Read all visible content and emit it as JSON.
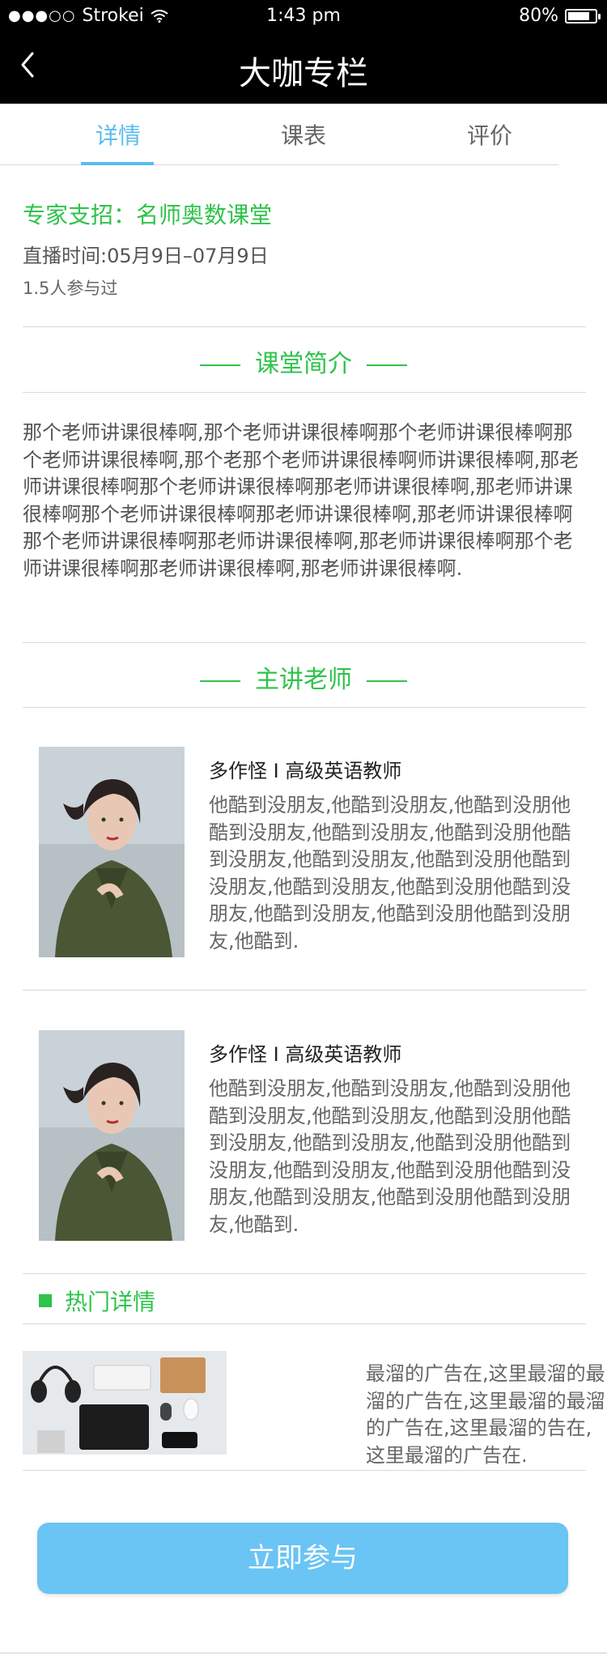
{
  "status_bar": {
    "carrier": "Strokei",
    "signal_dots": "●●●○○",
    "time": "1:43 pm",
    "battery_pct": "80%",
    "battery_level": 0.8
  },
  "nav": {
    "title": "大咖专栏"
  },
  "tabs": [
    {
      "label": "详情",
      "active": true
    },
    {
      "label": "课表",
      "active": false
    },
    {
      "label": "评价",
      "active": false
    }
  ],
  "course": {
    "expert": "专家支招：名师奥数课堂",
    "broadcast_time": "直播时间:05月9日–07月9日",
    "participants": "1.5人参与过"
  },
  "sections": {
    "intro_title": "课堂简介",
    "teacher_title": "主讲老师",
    "hot_title": "热门详情"
  },
  "intro_text": "那个老师讲课很棒啊,那个老师讲课很棒啊那个老师讲课很棒啊那个老师讲课很棒啊,那个老那个老师讲课很棒啊师讲课很棒啊,那老师讲课很棒啊那个老师讲课很棒啊那老师讲课很棒啊,那老师讲课很棒啊那个老师讲课很棒啊那老师讲课很棒啊,那老师讲课很棒啊那个老师讲课很棒啊那老师讲课很棒啊,那老师讲课很棒啊那个老师讲课很棒啊那老师讲课很棒啊,那老师讲课很棒啊.",
  "teachers": [
    {
      "name": "多作怪 I 高级英语教师",
      "desc": "他酷到没朋友,他酷到没朋友,他酷到没朋他酷到没朋友,他酷到没朋友,他酷到没朋他酷到没朋友,他酷到没朋友,他酷到没朋他酷到没朋友,他酷到没朋友,他酷到没朋他酷到没朋友,他酷到没朋友,他酷到没朋他酷到没朋友,他酷到."
    },
    {
      "name": "多作怪 I 高级英语教师",
      "desc": "他酷到没朋友,他酷到没朋友,他酷到没朋他酷到没朋友,他酷到没朋友,他酷到没朋他酷到没朋友,他酷到没朋友,他酷到没朋他酷到没朋友,他酷到没朋友,他酷到没朋他酷到没朋友,他酷到没朋友,他酷到没朋他酷到没朋友,他酷到."
    }
  ],
  "ad_text": "最溜的广告在,这里最溜的最溜的广告在,这里最溜的最溜的广告在,这里最溜的告在,这里最溜的广告在.",
  "join_button": "立即参与",
  "colors": {
    "accent_blue": "#5bbcf0",
    "button_blue": "#6ac4f4",
    "green": "#2ec34a",
    "black_bar": "#000000"
  }
}
